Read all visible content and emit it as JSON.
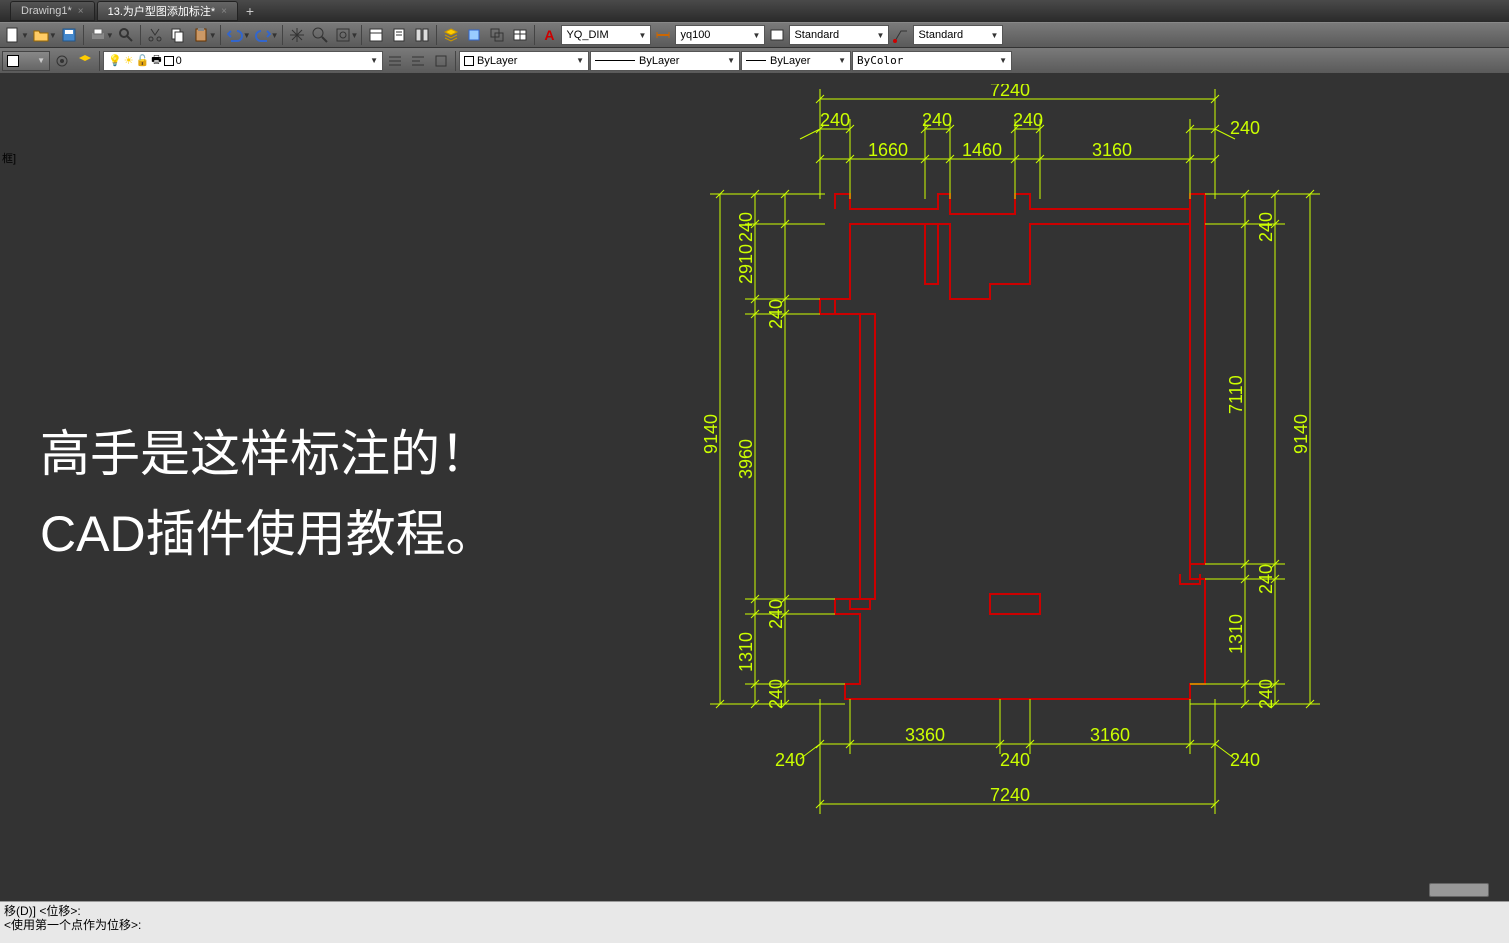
{
  "tabs": [
    {
      "label": "Drawing1*",
      "active": false
    },
    {
      "label": "13.为户型图添加标注*",
      "active": true
    }
  ],
  "toolbar1": {
    "dimstyle": "YQ_DIM",
    "linetype": "yq100",
    "textstyle1": "Standard",
    "textstyle2": "Standard"
  },
  "toolbar2": {
    "layer": "0",
    "bylayer1": "ByLayer",
    "bylayer2": "ByLayer",
    "bylayer3": "ByLayer",
    "bycolor": "ByColor"
  },
  "overlay": {
    "line1": "高手是这样标注的！",
    "line2": "CAD插件使用教程。"
  },
  "dims": {
    "top_overall": "7240",
    "top_240a": "240",
    "top_240b": "240",
    "top_240c": "240",
    "top_240d": "240",
    "top_1660": "1660",
    "top_1460": "1460",
    "top_3160": "3160",
    "left_240a": "240",
    "left_2910": "2910",
    "left_240b": "240",
    "left_3960": "3960",
    "left_240c": "240",
    "left_1310": "1310",
    "left_240d": "240",
    "left_overall": "9140",
    "right_240a": "240",
    "right_7110": "7110",
    "right_240b": "240",
    "right_1310": "1310",
    "right_240c": "240",
    "right_overall": "9140",
    "bot_240a": "240",
    "bot_3360": "3360",
    "bot_240b": "240",
    "bot_3160": "3160",
    "bot_240c": "240",
    "bot_overall": "7240"
  },
  "cmd": {
    "line1": "移(D)] <位移>:",
    "line2": "<使用第一个点作为位移>:"
  },
  "corner_label": "框]"
}
